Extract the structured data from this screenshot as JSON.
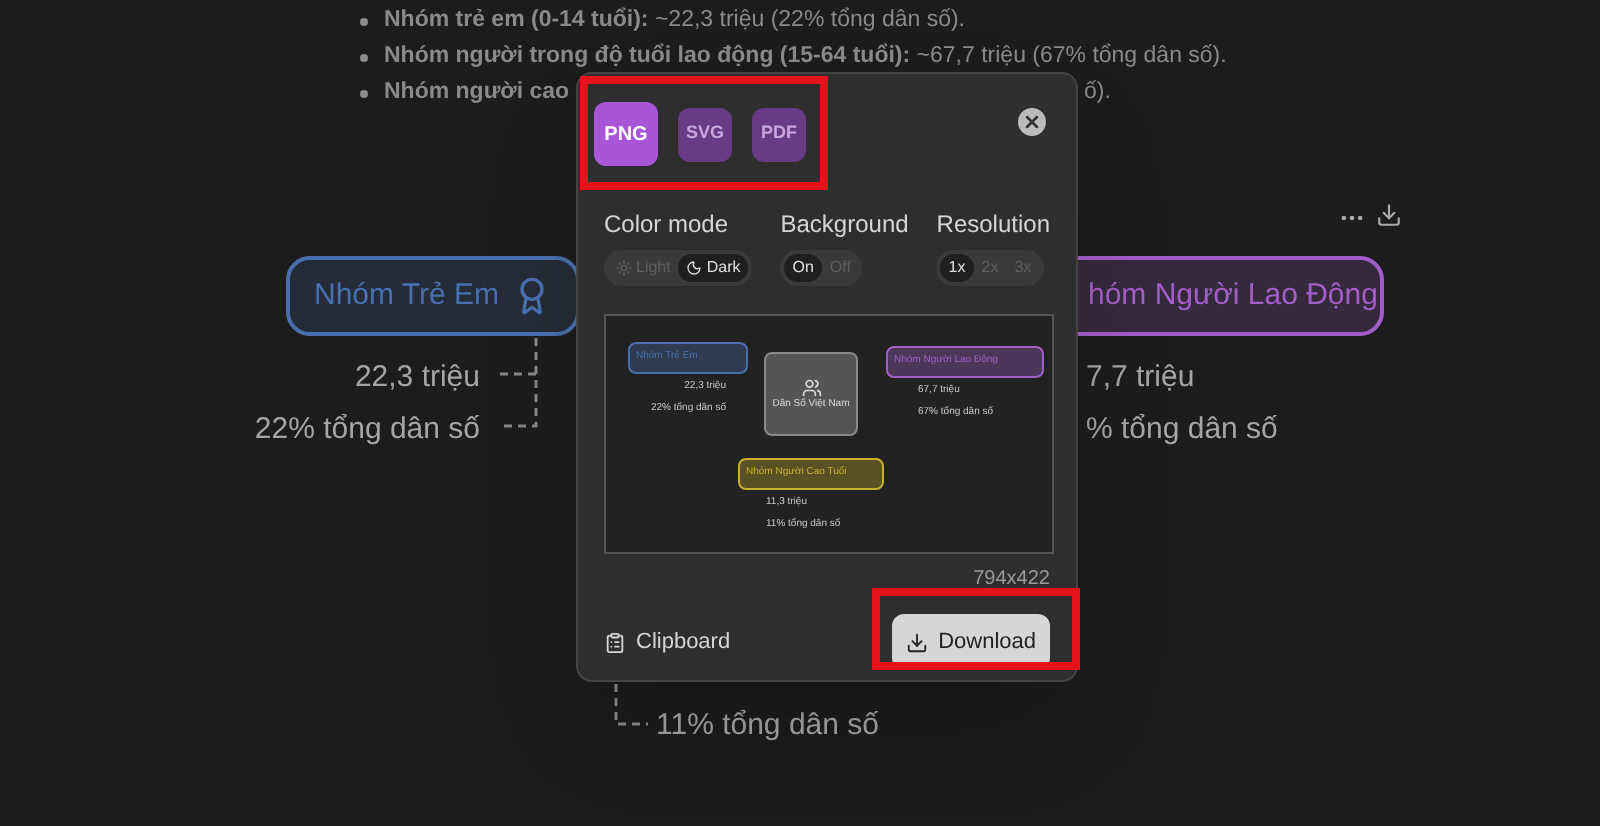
{
  "bullets": [
    {
      "label": "Nhóm trẻ em (0-14 tuổi):",
      "text": "~22,3 triệu (22% tổng dân số)."
    },
    {
      "label": "Nhóm người trong độ tuổi lao động (15-64 tuổi):",
      "text": "~67,7 triệu (67% tổng dân số)."
    },
    {
      "label": "Nhóm người cao",
      "text": "ố)."
    }
  ],
  "diagram": {
    "nodes": [
      {
        "label": "Nhóm Trẻ Em",
        "color": "#4a6fb0",
        "value": "22,3 triệu",
        "share": "22% tổng dân số"
      },
      {
        "label": "hóm Người Lao Động",
        "color": "#a25fc9",
        "value": "7,7 triệu",
        "share": "% tổng dân số"
      }
    ],
    "bottom_share": "11% tổng dân số"
  },
  "export_dialog": {
    "formats": [
      {
        "label": "PNG",
        "selected": true
      },
      {
        "label": "SVG",
        "selected": false
      },
      {
        "label": "PDF",
        "selected": false
      }
    ],
    "options": [
      {
        "label": "Color mode",
        "choices": [
          {
            "label": "Light",
            "selected": false
          },
          {
            "label": "Dark",
            "selected": true
          }
        ]
      },
      {
        "label": "Background",
        "choices": [
          {
            "label": "On",
            "selected": true
          },
          {
            "label": "Off",
            "selected": false
          }
        ]
      },
      {
        "label": "Resolution",
        "choices": [
          {
            "label": "1x",
            "selected": true
          },
          {
            "label": "2x",
            "selected": false
          },
          {
            "label": "3x",
            "selected": false
          }
        ]
      }
    ],
    "preview": {
      "center": "Dân Số Việt Nam",
      "nodes": [
        {
          "label": "Nhóm Trẻ Em",
          "color": "#4a6fb0",
          "value": "22,3 triệu",
          "share": "22% tổng dân số"
        },
        {
          "label": "Nhóm Người Lao Động",
          "color": "#a25fc9",
          "value": "67,7 triệu",
          "share": "67% tổng dân số"
        },
        {
          "label": "Nhóm Người Cao Tuổi",
          "color": "#c9b22a",
          "value": "11,3 triệu",
          "share": "11% tổng dân số"
        }
      ]
    },
    "size": "794x422",
    "clipboard": "Clipboard",
    "download": "Download"
  }
}
